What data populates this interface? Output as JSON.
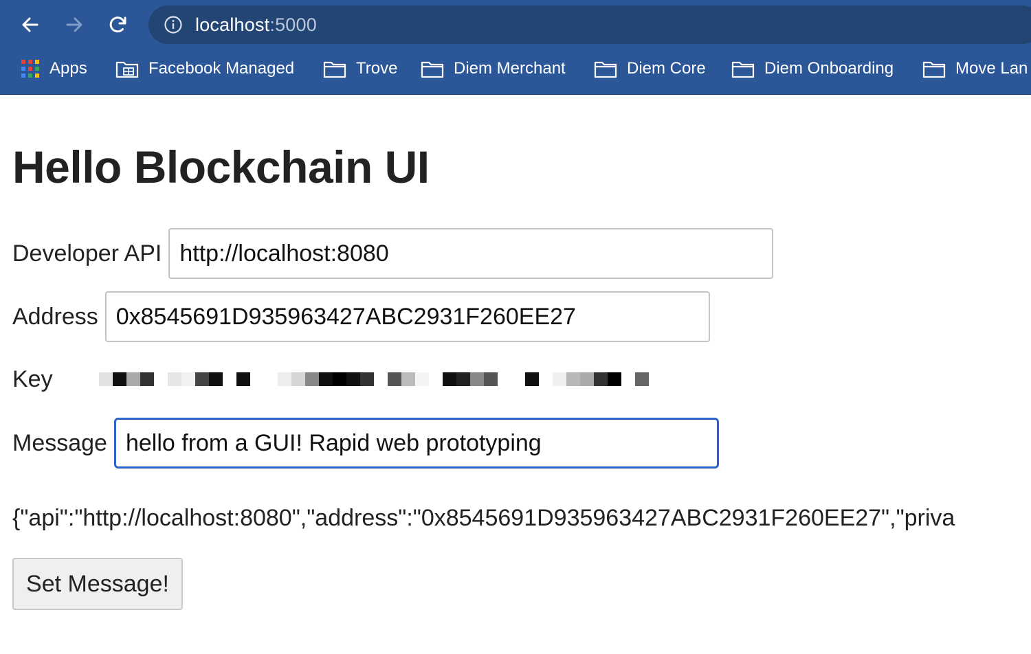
{
  "browser": {
    "url_host": "localhost",
    "url_port": ":5000",
    "bookmarks": [
      {
        "label": "Apps",
        "icon": "apps-grid-icon"
      },
      {
        "label": "Facebook Managed",
        "icon": "managed-folder-icon"
      },
      {
        "label": "Trove",
        "icon": "folder-icon"
      },
      {
        "label": "Diem Merchant",
        "icon": "folder-icon"
      },
      {
        "label": "Diem Core",
        "icon": "folder-icon"
      },
      {
        "label": "Diem Onboarding",
        "icon": "folder-icon"
      },
      {
        "label": "Move Lan",
        "icon": "folder-icon"
      }
    ],
    "colors": {
      "toolbar": "#2b5799",
      "omnibox": "#234574"
    }
  },
  "page": {
    "title": "Hello Blockchain UI",
    "fields": {
      "developer_api": {
        "label": "Developer API",
        "value": "http://localhost:8080"
      },
      "address": {
        "label": "Address",
        "value": "0x8545691D935963427ABC2931F260EE27"
      },
      "key": {
        "label": "Key"
      },
      "message": {
        "label": "Message",
        "value": "hello from a GUI! Rapid web prototyping"
      }
    },
    "json_output": "{\"api\":\"http://localhost:8080\",\"address\":\"0x8545691D935963427ABC2931F260EE27\",\"priva",
    "submit_label": "Set Message!",
    "colors": {
      "focus_border": "#2a63c8",
      "text": "#222222"
    }
  }
}
